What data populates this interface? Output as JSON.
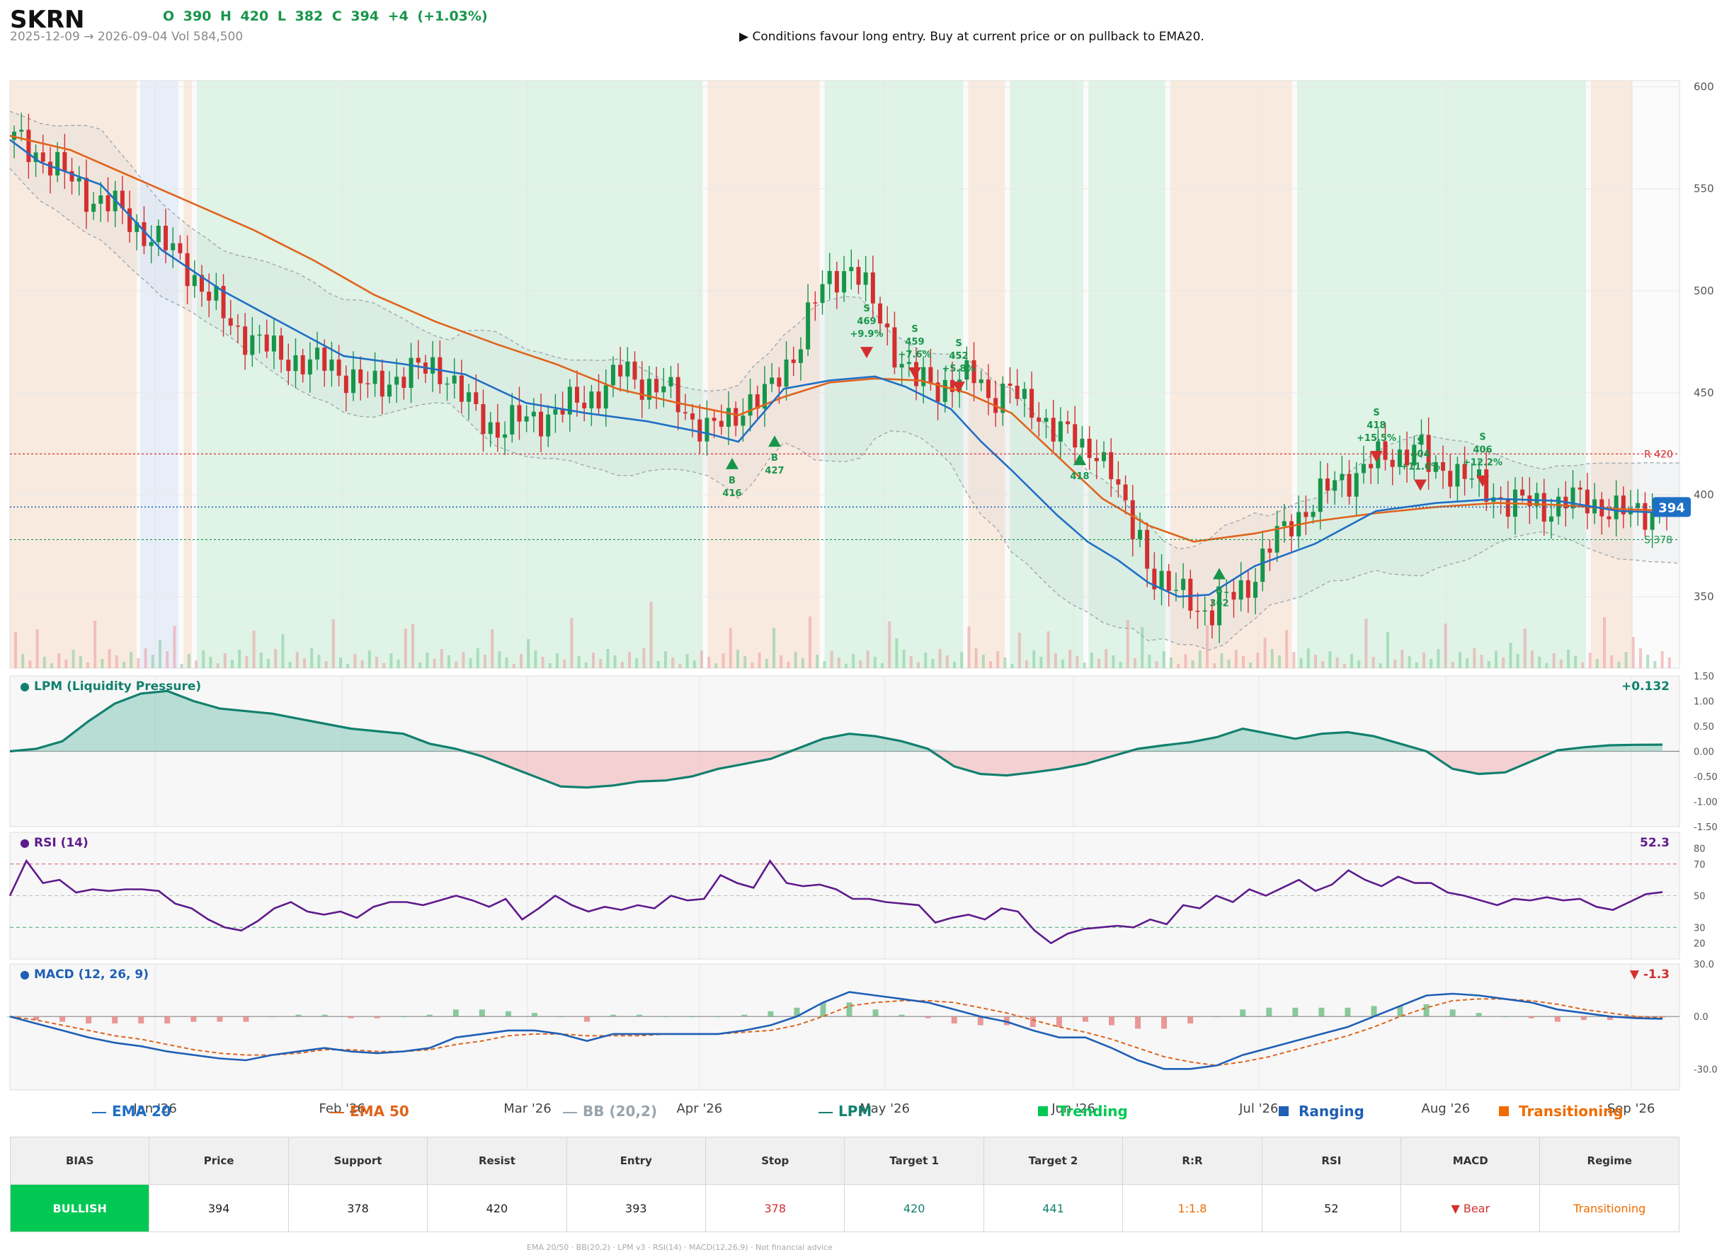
{
  "header": {
    "symbol": "SKRN",
    "ohlc": "O 390   H 420   L 382   C 394   +4  (+1.03%)",
    "range": "2025-12-09 → 2026-09-04   Vol 584,500",
    "signal": "▶  Conditions favour long entry. Buy at current price or on pullback to EMA20."
  },
  "colors": {
    "bull": "#17954a",
    "bear": "#d32f2f",
    "ema20": "#1f6fc5",
    "ema50": "#e0641c",
    "bb": "#9aa5ad",
    "lpm": "#12806e",
    "rsi": "#5e1b8c",
    "macd": "#1f5fb5",
    "signal": "#e0641c",
    "trending": "#00c853",
    "ranging": "#1f5fb5",
    "transitioning": "#ef6c00"
  },
  "chart_data": [
    {
      "type": "candlestick",
      "title": "SKRN",
      "x_ticks": [
        "Jan '26",
        "Feb '26",
        "Mar '26",
        "Apr '26",
        "May '26",
        "Jun '26",
        "Jul '26",
        "Aug '26",
        "Sep '26"
      ],
      "y_ticks": [
        350,
        400,
        450,
        500,
        550,
        600
      ],
      "ylim": [
        315,
        603
      ],
      "price_ohlc_last": {
        "open": 390,
        "high": 420,
        "low": 382,
        "close": 394
      },
      "last_price": 394,
      "resistance": {
        "label": "R 420",
        "value": 420
      },
      "support": {
        "label": "S 378",
        "value": 378
      },
      "close_path": [
        [
          0,
          574
        ],
        [
          6,
          567
        ],
        [
          12,
          557
        ],
        [
          18,
          546
        ],
        [
          24,
          541
        ],
        [
          30,
          530
        ],
        [
          40,
          516
        ],
        [
          45,
          500
        ],
        [
          50,
          488
        ],
        [
          55,
          478
        ],
        [
          60,
          472
        ],
        [
          65,
          468
        ],
        [
          70,
          463
        ],
        [
          75,
          465
        ],
        [
          80,
          457
        ],
        [
          85,
          452
        ],
        [
          90,
          457
        ],
        [
          95,
          460
        ],
        [
          100,
          463
        ],
        [
          103,
          460
        ],
        [
          106,
          450
        ],
        [
          110,
          440
        ],
        [
          115,
          432
        ],
        [
          120,
          436
        ],
        [
          125,
          438
        ],
        [
          130,
          441
        ],
        [
          135,
          446
        ],
        [
          140,
          451
        ],
        [
          145,
          461
        ],
        [
          150,
          455
        ],
        [
          155,
          452
        ],
        [
          160,
          440
        ],
        [
          165,
          433
        ],
        [
          170,
          434
        ],
        [
          175,
          447
        ],
        [
          180,
          449
        ],
        [
          185,
          466
        ],
        [
          188,
          480
        ],
        [
          190,
          493
        ],
        [
          195,
          505
        ],
        [
          200,
          514
        ],
        [
          205,
          491
        ],
        [
          210,
          471
        ],
        [
          215,
          456
        ],
        [
          220,
          452
        ],
        [
          225,
          458
        ],
        [
          230,
          456
        ],
        [
          232,
          446
        ],
        [
          235,
          452
        ],
        [
          238,
          454
        ],
        [
          240,
          443
        ],
        [
          245,
          438
        ],
        [
          250,
          432
        ],
        [
          255,
          420
        ],
        [
          258,
          424
        ],
        [
          262,
          410
        ],
        [
          266,
          382
        ],
        [
          268,
          385
        ],
        [
          270,
          367
        ],
        [
          275,
          352
        ],
        [
          280,
          352
        ],
        [
          283,
          343
        ],
        [
          286,
          341
        ],
        [
          290,
          351
        ],
        [
          295,
          358
        ],
        [
          300,
          376
        ],
        [
          305,
          389
        ],
        [
          310,
          395
        ],
        [
          315,
          407
        ],
        [
          320,
          410
        ],
        [
          325,
          417
        ],
        [
          330,
          420
        ],
        [
          335,
          424
        ],
        [
          338,
          410
        ],
        [
          341,
          414
        ],
        [
          345,
          411
        ],
        [
          350,
          402
        ],
        [
          355,
          398
        ],
        [
          360,
          396
        ],
        [
          365,
          393
        ],
        [
          370,
          398
        ],
        [
          375,
          396
        ],
        [
          380,
          394
        ],
        [
          385,
          390
        ],
        [
          390,
          392
        ],
        [
          394,
          394
        ]
      ],
      "ema20_path": [
        [
          0,
          574
        ],
        [
          10,
          563
        ],
        [
          30,
          552
        ],
        [
          50,
          520
        ],
        [
          70,
          500
        ],
        [
          90,
          484
        ],
        [
          110,
          468
        ],
        [
          130,
          464
        ],
        [
          150,
          459
        ],
        [
          170,
          445
        ],
        [
          190,
          440
        ],
        [
          210,
          436
        ],
        [
          230,
          430
        ],
        [
          240,
          426
        ],
        [
          255,
          452
        ],
        [
          270,
          456
        ],
        [
          285,
          458
        ],
        [
          295,
          453
        ],
        [
          310,
          442
        ],
        [
          320,
          426
        ],
        [
          330,
          412
        ],
        [
          345,
          390
        ],
        [
          355,
          377
        ],
        [
          365,
          368
        ],
        [
          375,
          357
        ],
        [
          385,
          350
        ],
        [
          395,
          351
        ],
        [
          410,
          365
        ],
        [
          430,
          376
        ],
        [
          450,
          392
        ],
        [
          470,
          396
        ],
        [
          490,
          398
        ],
        [
          510,
          397
        ],
        [
          530,
          392
        ],
        [
          550,
          391
        ]
      ],
      "ema50_path": [
        [
          0,
          576
        ],
        [
          20,
          569
        ],
        [
          40,
          556
        ],
        [
          60,
          543
        ],
        [
          80,
          530
        ],
        [
          100,
          515
        ],
        [
          120,
          498
        ],
        [
          140,
          485
        ],
        [
          160,
          474
        ],
        [
          180,
          464
        ],
        [
          200,
          452
        ],
        [
          220,
          445
        ],
        [
          240,
          439
        ],
        [
          255,
          448
        ],
        [
          270,
          455
        ],
        [
          285,
          457
        ],
        [
          300,
          456
        ],
        [
          315,
          450
        ],
        [
          330,
          440
        ],
        [
          345,
          419
        ],
        [
          360,
          398
        ],
        [
          375,
          385
        ],
        [
          390,
          377
        ],
        [
          410,
          381
        ],
        [
          430,
          387
        ],
        [
          450,
          391
        ],
        [
          470,
          394
        ],
        [
          490,
          396
        ],
        [
          510,
          395
        ],
        [
          530,
          393
        ],
        [
          550,
          392
        ]
      ],
      "signals": [
        {
          "side": "B",
          "text": "B\n416",
          "price": 416
        },
        {
          "side": "B",
          "text": "B\n427",
          "price": 427
        },
        {
          "side": "S",
          "text": "S\n469\n+9.9%",
          "price": 469
        },
        {
          "side": "S",
          "text": "S\n459\n+7.6%",
          "price": 459
        },
        {
          "side": "S",
          "text": "S\n452\n+5.8%",
          "price": 452
        },
        {
          "side": "B",
          "text": "418",
          "price": 418
        },
        {
          "side": "B",
          "text": "B\n362",
          "price": 362
        },
        {
          "side": "S",
          "text": "S\n418\n+15.5%",
          "price": 418
        },
        {
          "side": "S",
          "text": "S\n404\n+11.6%",
          "price": 404
        },
        {
          "side": "S",
          "text": "S\n406\n+12.2%",
          "price": 406
        }
      ]
    },
    {
      "type": "area",
      "title": "LPM (Liquidity Pressure)",
      "last_value": "+0.132",
      "y_ticks": [
        1.5,
        1.0,
        0.5,
        0.0,
        -0.5,
        -1.0,
        -1.5
      ],
      "y_tick_labels": [
        "1.50",
        "1.00",
        "0.50",
        "0.00",
        "-0.50",
        "-1.00",
        "-1.50"
      ],
      "ylim": [
        -1.5,
        1.5
      ],
      "values": [
        0,
        0.05,
        0.2,
        0.6,
        0.95,
        1.15,
        1.2,
        1.0,
        0.85,
        0.8,
        0.75,
        0.65,
        0.55,
        0.45,
        0.4,
        0.35,
        0.15,
        0.05,
        -0.1,
        -0.3,
        -0.5,
        -0.7,
        -0.72,
        -0.68,
        -0.6,
        -0.58,
        -0.5,
        -0.35,
        -0.25,
        -0.15,
        0.05,
        0.25,
        0.35,
        0.3,
        0.2,
        0.05,
        -0.3,
        -0.45,
        -0.48,
        -0.42,
        -0.35,
        -0.25,
        -0.1,
        0.05,
        0.12,
        0.18,
        0.28,
        0.45,
        0.35,
        0.25,
        0.35,
        0.38,
        0.3,
        0.15,
        0,
        -0.35,
        -0.45,
        -0.42,
        -0.2,
        0.02,
        0.08,
        0.12,
        0.13,
        0.132
      ]
    },
    {
      "type": "line",
      "title": "RSI (14)",
      "last_value": "52.3",
      "y_ticks": [
        80,
        70,
        50,
        30,
        20
      ],
      "ylim": [
        10,
        90
      ],
      "values": [
        50,
        72,
        58,
        60,
        52,
        54,
        53,
        54,
        54,
        53,
        45,
        42,
        35,
        30,
        28,
        34,
        42,
        46,
        40,
        38,
        40,
        36,
        43,
        46,
        46,
        44,
        47,
        50,
        47,
        43,
        48,
        35,
        42,
        50,
        44,
        40,
        43,
        41,
        44,
        42,
        50,
        47,
        48,
        63,
        58,
        55,
        72,
        58,
        56,
        57,
        54,
        48,
        48,
        46,
        45,
        44,
        33,
        36,
        38,
        35,
        42,
        40,
        28,
        20,
        26,
        29,
        30,
        31,
        30,
        35,
        32,
        44,
        42,
        50,
        46,
        54,
        50,
        55,
        60,
        53,
        57,
        66,
        60,
        56,
        62,
        58,
        58,
        52,
        50,
        47,
        44,
        48,
        47,
        49,
        47,
        48,
        43,
        41,
        46,
        51,
        52.3
      ]
    },
    {
      "type": "line",
      "title": "MACD (12, 26, 9)",
      "last_value": "▼ -1.3",
      "y_ticks": [
        30,
        0,
        -30
      ],
      "y_tick_labels": [
        "30.0",
        "0.0",
        "-30.0"
      ],
      "ylim": [
        -42,
        30
      ],
      "macd": [
        0,
        -4,
        -8,
        -12,
        -15,
        -17,
        -20,
        -22,
        -24,
        -25,
        -22,
        -20,
        -18,
        -20,
        -21,
        -20,
        -18,
        -12,
        -10,
        -8,
        -8,
        -10,
        -14,
        -10,
        -10,
        -10,
        -10,
        -10,
        -8,
        -5,
        0,
        8,
        14,
        12,
        10,
        8,
        4,
        0,
        -3,
        -8,
        -12,
        -12,
        -18,
        -25,
        -30,
        -30,
        -28,
        -22,
        -18,
        -14,
        -10,
        -6,
        0,
        6,
        12,
        13,
        12,
        10,
        8,
        4,
        2,
        0,
        -1,
        -1.3
      ],
      "signal": [
        0,
        -2,
        -5,
        -8,
        -11,
        -13,
        -16,
        -19,
        -21,
        -22,
        -22,
        -21,
        -19,
        -19,
        -20,
        -20,
        -19,
        -16,
        -14,
        -11,
        -10,
        -10,
        -11,
        -11,
        -11,
        -10,
        -10,
        -10,
        -9,
        -8,
        -5,
        0,
        6,
        8,
        9,
        9,
        8,
        5,
        2,
        -2,
        -6,
        -9,
        -13,
        -18,
        -23,
        -26,
        -28,
        -26,
        -23,
        -19,
        -15,
        -11,
        -6,
        0,
        5,
        9,
        10,
        10,
        9,
        7,
        4,
        2,
        0,
        -0.7
      ],
      "histogram_note": "bars = macd - signal"
    }
  ],
  "regimes": [
    {
      "type": "transitioning",
      "from": 0.0,
      "to": 0.076
    },
    {
      "type": "ranging",
      "from": 0.078,
      "to": 0.101
    },
    {
      "type": "transitioning",
      "from": 0.104,
      "to": 0.109
    },
    {
      "type": "trending",
      "from": 0.112,
      "to": 0.415
    },
    {
      "type": "transitioning",
      "from": 0.418,
      "to": 0.485
    },
    {
      "type": "trending",
      "from": 0.488,
      "to": 0.571
    },
    {
      "type": "transitioning",
      "from": 0.574,
      "to": 0.596
    },
    {
      "type": "trending",
      "from": 0.599,
      "to": 0.643
    },
    {
      "type": "trending",
      "from": 0.646,
      "to": 0.692
    },
    {
      "type": "transitioning",
      "from": 0.695,
      "to": 0.768
    },
    {
      "type": "trending",
      "from": 0.771,
      "to": 0.944
    },
    {
      "type": "transitioning",
      "from": 0.947,
      "to": 0.972
    }
  ],
  "legend": [
    {
      "label": "EMA 20",
      "marker": "line",
      "color": "#1f6fc5"
    },
    {
      "label": "EMA 50",
      "marker": "line",
      "color": "#e0641c"
    },
    {
      "label": "BB (20,2)",
      "marker": "line",
      "color": "#9aa5ad"
    },
    {
      "label": "LPM",
      "marker": "line",
      "color": "#12806e"
    },
    {
      "label": "Trending",
      "marker": "square",
      "color": "#00c853"
    },
    {
      "label": "Ranging",
      "marker": "square",
      "color": "#1f5fb5"
    },
    {
      "label": "Transitioning",
      "marker": "square",
      "color": "#ef6c00"
    }
  ],
  "summary": {
    "headers": [
      "BIAS",
      "Price",
      "Support",
      "Resist",
      "Entry",
      "Stop",
      "Target 1",
      "Target 2",
      "R:R",
      "RSI",
      "MACD",
      "Regime"
    ],
    "values": [
      "BULLISH",
      "394",
      "378",
      "420",
      "393",
      "378",
      "420",
      "441",
      "1:1.8",
      "52",
      "▼ Bear",
      "Transitioning"
    ],
    "value_colors": [
      "#ffffff",
      "#222222",
      "#222222",
      "#222222",
      "#222222",
      "#d32f2f",
      "#12806e",
      "#12806e",
      "#ef6c00",
      "#222222",
      "#d32f2f",
      "#ef6c00"
    ]
  },
  "footer": "EMA 20/50  ·  BB(20,2)  ·  LPM v3  ·  RSI(14)  ·  MACD(12,26,9)  ·  Not financial advice"
}
